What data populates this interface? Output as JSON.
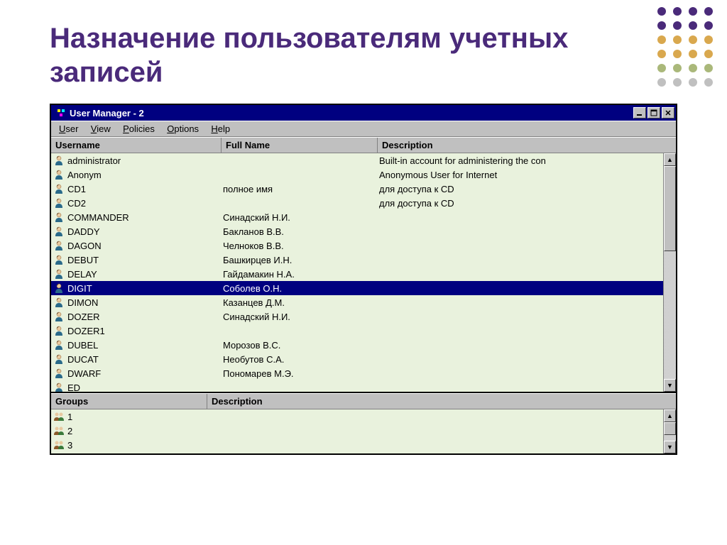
{
  "slide": {
    "title": "Назначение пользователям учетных записей"
  },
  "window": {
    "title": "User Manager - 2",
    "menus": {
      "user": "User",
      "view": "View",
      "policies": "Policies",
      "options": "Options",
      "help": "Help"
    },
    "columns": {
      "username": "Username",
      "fullname": "Full Name",
      "description": "Description"
    },
    "users": [
      {
        "username": "administrator",
        "fullname": "",
        "description": "Built-in account for administering the con",
        "selected": false
      },
      {
        "username": "Anonym",
        "fullname": "",
        "description": "Anonymous User for Internet",
        "selected": false
      },
      {
        "username": "CD1",
        "fullname": "полное имя",
        "description": "для доступа к CD",
        "selected": false
      },
      {
        "username": "CD2",
        "fullname": "",
        "description": "для доступа к CD",
        "selected": false
      },
      {
        "username": "COMMANDER",
        "fullname": "Синадский Н.И.",
        "description": "",
        "selected": false
      },
      {
        "username": "DADDY",
        "fullname": "Бакланов В.В.",
        "description": "",
        "selected": false
      },
      {
        "username": "DAGON",
        "fullname": "Челноков В.В.",
        "description": "",
        "selected": false
      },
      {
        "username": "DEBUT",
        "fullname": "Башкирцев И.Н.",
        "description": "",
        "selected": false
      },
      {
        "username": "DELAY",
        "fullname": "Гайдамакин Н.А.",
        "description": "",
        "selected": false
      },
      {
        "username": "DIGIT",
        "fullname": "Соболев О.Н.",
        "description": "",
        "selected": true
      },
      {
        "username": "DIMON",
        "fullname": "Казанцев Д.М.",
        "description": "",
        "selected": false
      },
      {
        "username": "DOZER",
        "fullname": "Синадский Н.И.",
        "description": "",
        "selected": false
      },
      {
        "username": "DOZER1",
        "fullname": "",
        "description": "",
        "selected": false
      },
      {
        "username": "DUBEL",
        "fullname": "Морозов В.С.",
        "description": "",
        "selected": false
      },
      {
        "username": "DUCAT",
        "fullname": "Необутов С.А.",
        "description": "",
        "selected": false
      },
      {
        "username": "DWARF",
        "fullname": "Пономарев М.Э.",
        "description": "",
        "selected": false
      },
      {
        "username": "ED",
        "fullname": "",
        "description": "",
        "selected": false
      }
    ],
    "groups_columns": {
      "groups": "Groups",
      "description": "Description"
    },
    "groups": [
      {
        "name": "1",
        "description": ""
      },
      {
        "name": "2",
        "description": ""
      },
      {
        "name": "3",
        "description": ""
      }
    ]
  }
}
